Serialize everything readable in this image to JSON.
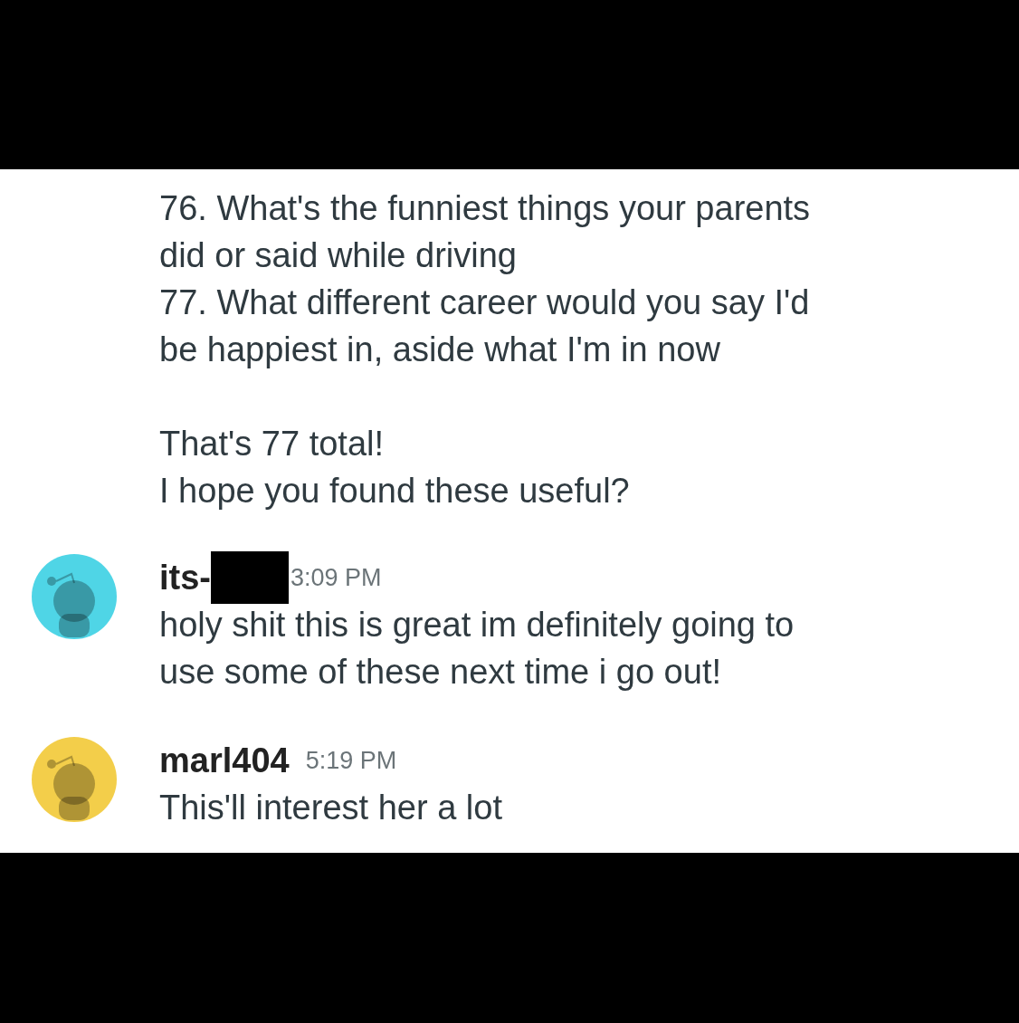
{
  "previous_message": {
    "paragraphs": [
      {
        "lines": [
          "76. What's the funniest things your parents",
          "did or said while driving",
          "77. What different career would you say I'd",
          "be happiest in, aside what I'm in now"
        ]
      },
      {
        "lines": [
          "That's 77 total!",
          "I hope you found these useful?"
        ]
      }
    ]
  },
  "messages": [
    {
      "username": "its-",
      "redacted": true,
      "time": "3:09 PM",
      "color": "#4fd5e6",
      "lines": [
        "holy shit this is great im definitely going to",
        "use some of these next time i go out!"
      ]
    },
    {
      "username": "marl404",
      "redacted": false,
      "time": "5:19 PM",
      "color": "#f3ce4a",
      "lines": [
        "This'll interest her a lot"
      ]
    }
  ]
}
